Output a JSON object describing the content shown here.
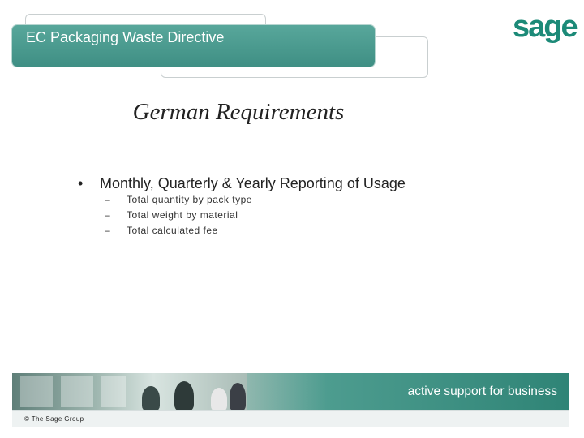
{
  "slide": {
    "header_title": "EC Packaging Waste Directive",
    "logo_text": "sage",
    "heading": "German Requirements",
    "bullet": {
      "marker": "•",
      "text": "Monthly, Quarterly & Yearly Reporting of Usage",
      "subitems": [
        {
          "marker": "–",
          "text": "Total quantity by pack type"
        },
        {
          "marker": "–",
          "text": "Total weight by material"
        },
        {
          "marker": "–",
          "text": "Total calculated fee"
        }
      ]
    },
    "footer": {
      "tagline": "active support for business",
      "copyright": "© The Sage Group"
    }
  },
  "colors": {
    "accent": "#3f8f84",
    "brand_green": "#1c8a78",
    "footer_band": "#2f8476"
  }
}
